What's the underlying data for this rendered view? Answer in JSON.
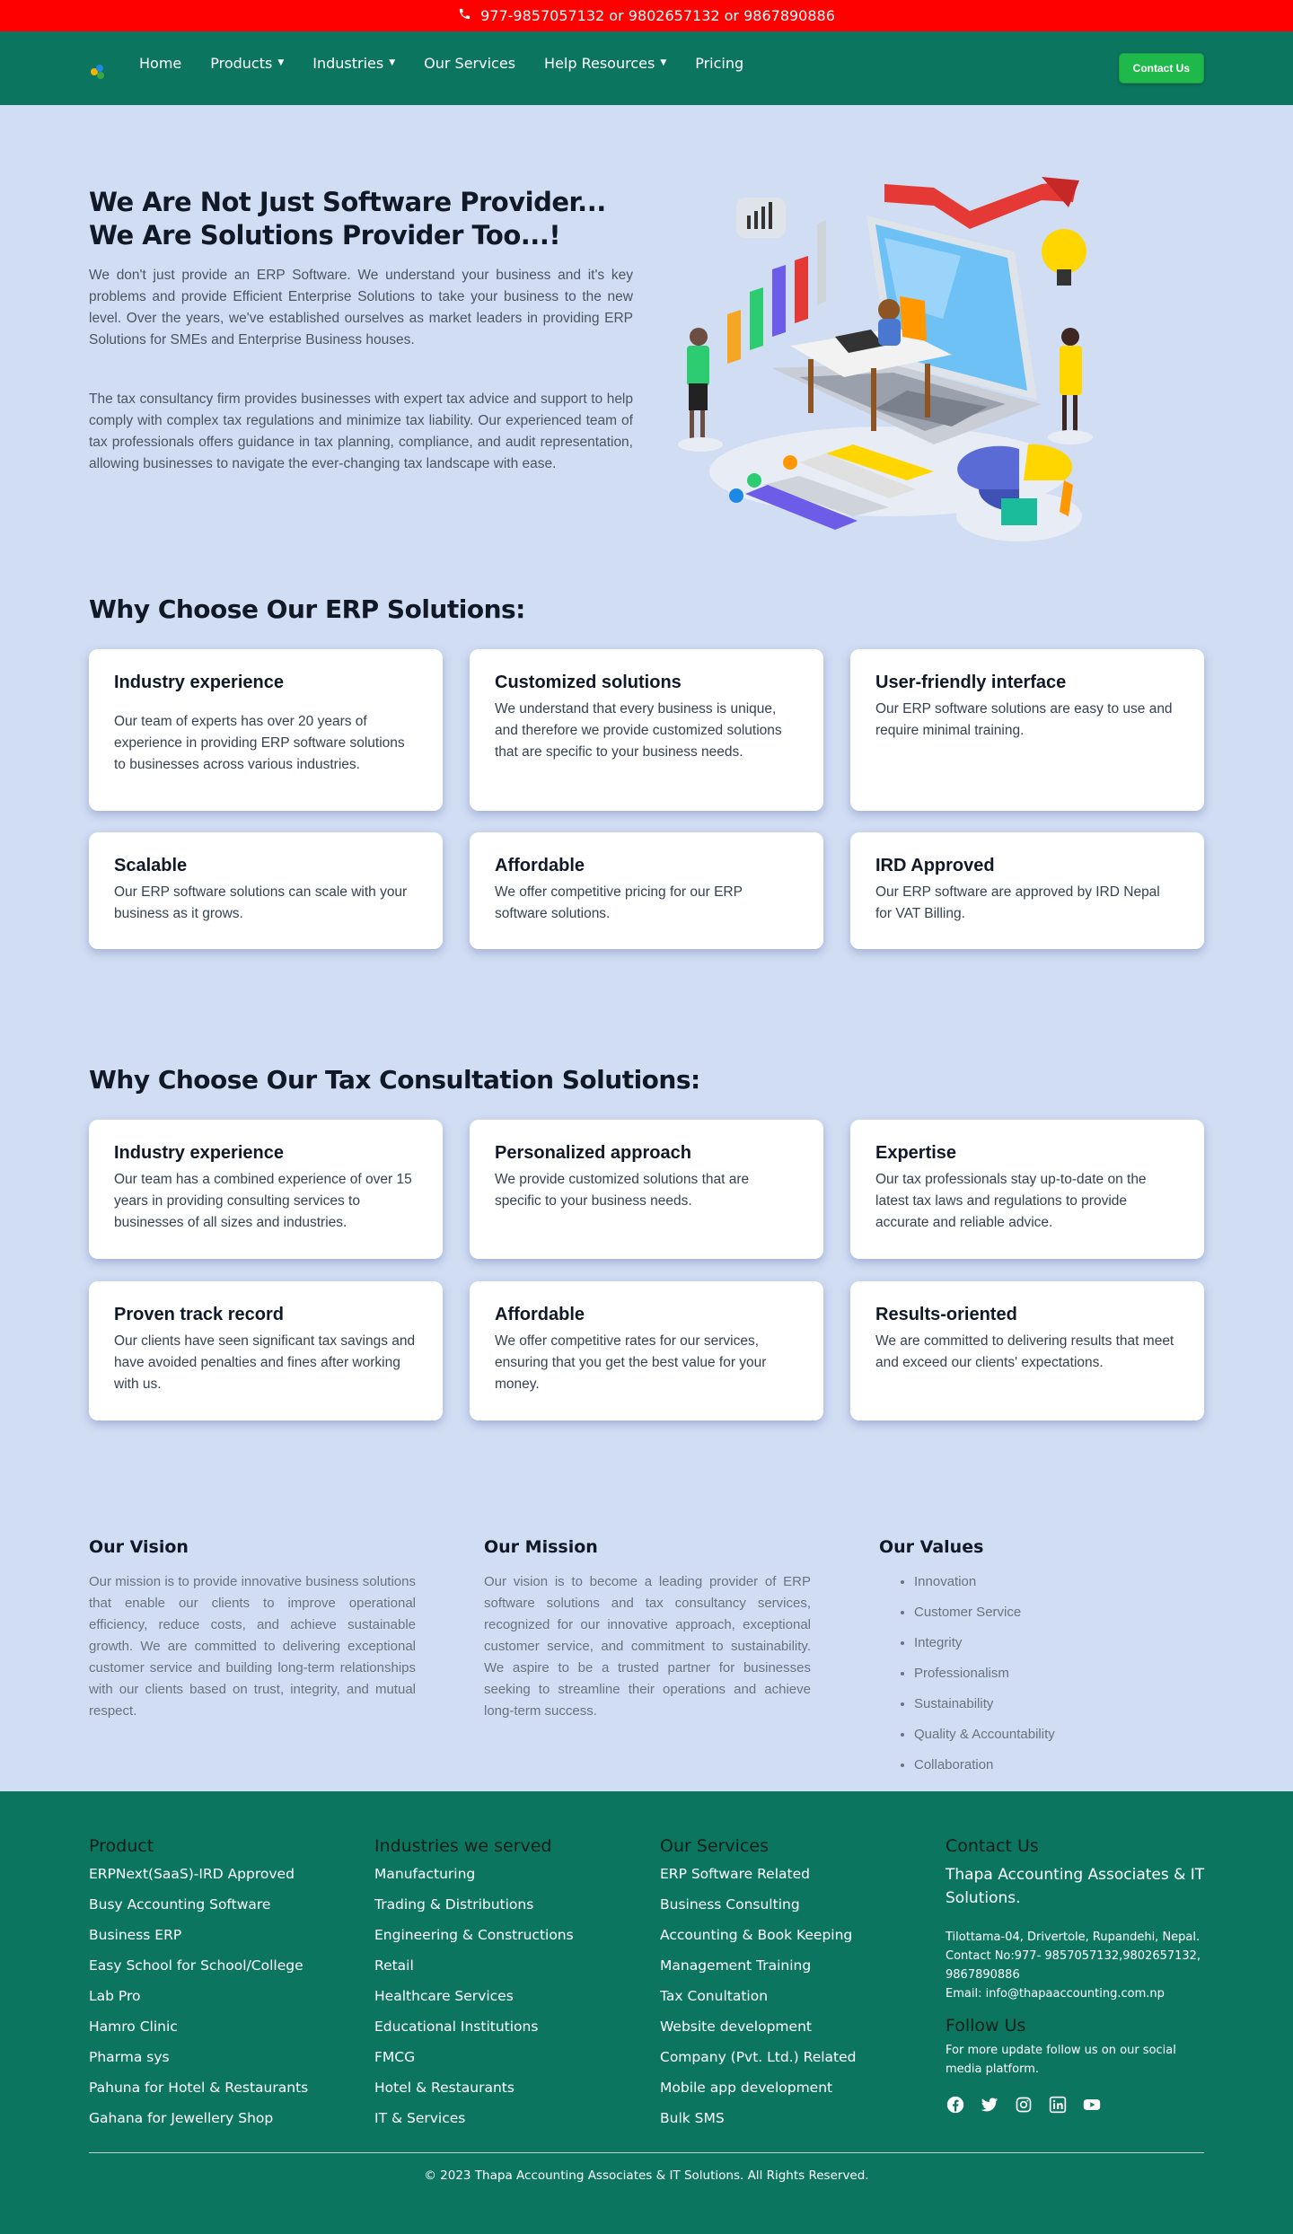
{
  "topbar": {
    "phone": "977-9857057132 or 9802657132 or 9867890886"
  },
  "nav": {
    "items": [
      "Home",
      "Products",
      "Industries",
      "Our Services",
      "Help Resources",
      "Pricing"
    ],
    "contact_label": "Contact Us"
  },
  "hero": {
    "title_line1": "We Are Not Just Software Provider...",
    "title_line2": "We Are Solutions Provider Too...!",
    "p1": "We don't just provide an ERP Software. We understand your business and it's key problems and provide Efficient Enterprise Solutions to take your business to the new level. Over the years, we've established ourselves as market leaders in providing ERP Solutions for SMEs and Enterprise Business houses.",
    "p2": "The tax consultancy firm provides businesses with expert tax advice and support to help comply with complex tax regulations and minimize tax liability. Our experienced team of tax professionals offers guidance in tax planning, compliance, and audit representation, allowing businesses to navigate the ever-changing tax landscape with ease."
  },
  "erp": {
    "title": "Why Choose Our ERP Solutions:",
    "cards": [
      {
        "title": "Industry experience",
        "text": "Our team of experts has over 20 years of experience in providing ERP software solutions to businesses across various industries."
      },
      {
        "title": "Customized solutions",
        "text": "We understand that every business is unique, and therefore we provide customized solutions that are specific to your business needs."
      },
      {
        "title": "User-friendly interface",
        "text": "Our ERP software solutions are easy to use and require minimal training."
      },
      {
        "title": "Scalable",
        "text": "Our ERP software solutions can scale with your business as it grows."
      },
      {
        "title": "Affordable",
        "text": "We offer competitive pricing for our ERP software solutions."
      },
      {
        "title": "IRD Approved",
        "text": "Our ERP software are approved by IRD Nepal for VAT Billing."
      }
    ]
  },
  "tax": {
    "title": "Why Choose Our Tax Consultation Solutions:",
    "cards": [
      {
        "title": "Industry experience",
        "text": "Our team has a combined experience of over 15 years in providing consulting services to businesses of all sizes and industries."
      },
      {
        "title": "Personalized approach",
        "text": "We provide customized solutions that are specific to your business needs."
      },
      {
        "title": "Expertise",
        "text": "Our tax professionals stay up-to-date on the latest tax laws and regulations to provide accurate and reliable advice."
      },
      {
        "title": "Proven track record",
        "text": "Our clients have seen significant tax savings and have avoided penalties and fines after working with us."
      },
      {
        "title": "Affordable",
        "text": "We offer competitive rates for our services, ensuring that you get the best value for your money."
      },
      {
        "title": "Results-oriented",
        "text": "We are committed to delivering results that meet and exceed our clients' expectations."
      }
    ]
  },
  "vision": {
    "title": "Our Vision",
    "text": "Our mission is to provide innovative business solutions that enable our clients to improve operational efficiency, reduce costs, and achieve sustainable growth. We are committed to delivering exceptional customer service and building long-term relationships with our clients based on trust, integrity, and mutual respect."
  },
  "mission": {
    "title": "Our Mission",
    "text": "Our vision is to become a leading provider of ERP software solutions and tax consultancy services, recognized for our innovative approach, exceptional customer service, and commitment to sustainability. We aspire to be a trusted partner for businesses seeking to streamline their operations and achieve long-term success."
  },
  "values": {
    "title": "Our Values",
    "items": [
      "Innovation",
      "Customer Service",
      "Integrity",
      "Professionalism",
      "Sustainability",
      "Quality & Accountability",
      "Collaboration"
    ]
  },
  "footer": {
    "product": {
      "title": "Product",
      "items": [
        "ERPNext(SaaS)-IRD Approved",
        "Busy Accounting Software",
        "Business ERP",
        "Easy School for School/College",
        "Lab Pro",
        "Hamro Clinic",
        "Pharma sys",
        "Pahuna for Hotel & Restaurants",
        "Gahana for Jewellery Shop"
      ]
    },
    "industries": {
      "title": "Industries we served",
      "items": [
        "Manufacturing",
        "Trading & Distributions",
        "Engineering & Constructions",
        "Retail",
        "Healthcare Services",
        "Educational Institutions",
        "FMCG",
        "Hotel & Restaurants",
        "IT & Services"
      ]
    },
    "services": {
      "title": "Our Services",
      "items": [
        "ERP Software Related",
        "Business Consulting",
        "Accounting & Book Keeping",
        "Management Training",
        "Tax Conultation",
        "Website development",
        "Company (Pvt. Ltd.) Related",
        "Mobile app development",
        "Bulk SMS"
      ]
    },
    "contact": {
      "title": "Contact Us",
      "company": "Thapa Accounting Associates & IT Solutions.",
      "address": "Tilottama-04, Drivertole, Rupandehi, Nepal.",
      "phone": "Contact No:977- 9857057132,9802657132, 9867890886",
      "email": "Email: info@thapaaccounting.com.np",
      "follow_title": "Follow Us",
      "follow_text": "For more update follow us on our social media platform."
    },
    "copyright": "© 2023 Thapa Accounting Associates & IT Solutions. All Rights Reserved."
  },
  "colors": {
    "topbar": "#ff0000",
    "nav": "#0c7560",
    "page_bg": "#d0ddf3",
    "contact_btn": "#1fb84a"
  }
}
